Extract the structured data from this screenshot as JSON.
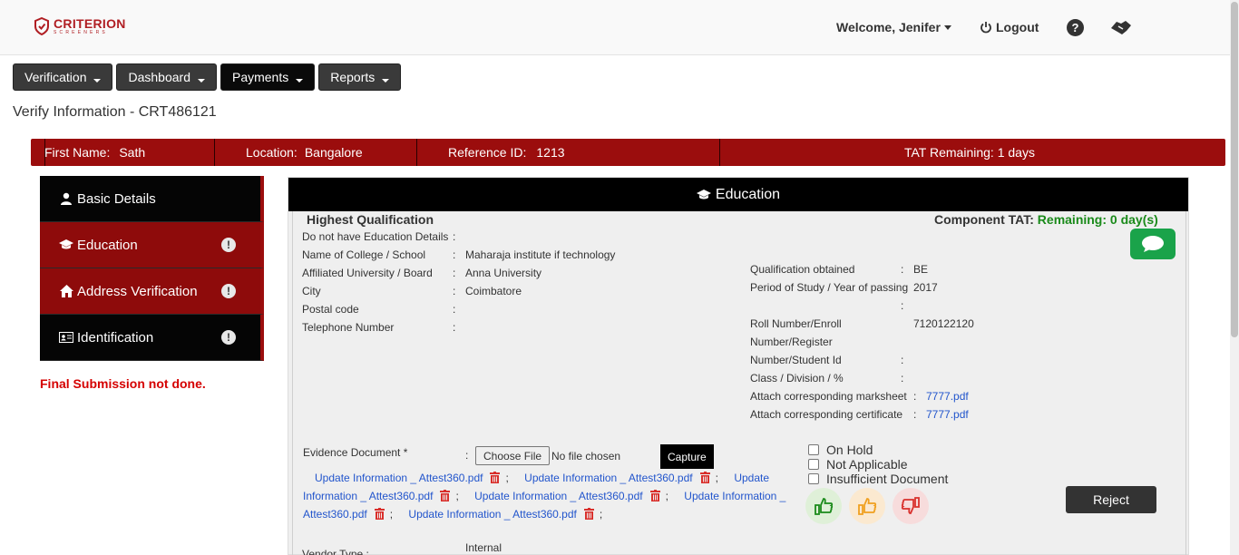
{
  "header": {
    "logo_main": "CRITERION",
    "logo_sub": "SCREENERS",
    "welcome": "Welcome, Jenifer",
    "logout": "Logout",
    "help": "?"
  },
  "nav": [
    {
      "label": "Verification"
    },
    {
      "label": "Dashboard"
    },
    {
      "label": "Payments"
    },
    {
      "label": "Reports"
    }
  ],
  "page_title": "Verify Information - CRT486121",
  "infobar": {
    "first_name_label": "First Name:",
    "first_name": "Sath",
    "location_label": "Location:",
    "location": "Bangalore",
    "reference_label": "Reference ID:",
    "reference": "1213",
    "tat": "TAT Remaining: 1 days"
  },
  "sidebar": [
    {
      "label": "Basic Details",
      "icon": "user-icon"
    },
    {
      "label": "Education",
      "icon": "graduation-cap-icon"
    },
    {
      "label": "Address Verification",
      "icon": "home-icon"
    },
    {
      "label": "Identification",
      "icon": "id-card-icon"
    }
  ],
  "final_submission": "Final Submission not done.",
  "panel": {
    "title": "Education",
    "highest_qualification": "Highest Qualification",
    "component_tat_label": "Component TAT:",
    "component_tat_value": "Remaining: 0 day(s)"
  },
  "fields_left": [
    {
      "label": "Do not have Education Details",
      "sep": ":",
      "value": ""
    },
    {
      "label": "Name of College / School",
      "sep": ":",
      "value": "Maharaja institute if technology"
    },
    {
      "label": "Affiliated University / Board",
      "sep": ":",
      "value": "Anna University"
    },
    {
      "label": "City",
      "sep": ":",
      "value": "Coimbatore"
    },
    {
      "label": "Postal code",
      "sep": ":",
      "value": ""
    },
    {
      "label": "Telephone Number",
      "sep": ":",
      "value": ""
    }
  ],
  "fields_right": {
    "qualification_label": "Qualification obtained",
    "qualification_value": "BE",
    "period_label": "Period of Study / Year of passing",
    "period_value": "2017",
    "roll_label_1": "Roll Number/Enroll",
    "roll_value": "7120122120",
    "roll_label_2": "Number/Register",
    "roll_label_3": "Number/Student Id",
    "class_label": "Class / Division / %",
    "marksheet_label": "Attach corresponding marksheet",
    "marksheet_value": "7777.pdf",
    "certificate_label": "Attach corresponding certificate",
    "certificate_value": "7777.pdf",
    "sep": ":"
  },
  "evidence": {
    "label": "Evidence Document *",
    "sep": ":",
    "choose_label": "Choose File",
    "no_file": "No file chosen",
    "capture_label": "Capture",
    "file_name": "Update Information _ Attest360.pdf",
    "delimiter": ";"
  },
  "checkboxes": [
    "On Hold",
    "Not Applicable",
    "Insufficient Document"
  ],
  "reject_label": "Reject",
  "vendor_type_label": "Vendor Type :",
  "vendor_type_value": "Internal"
}
